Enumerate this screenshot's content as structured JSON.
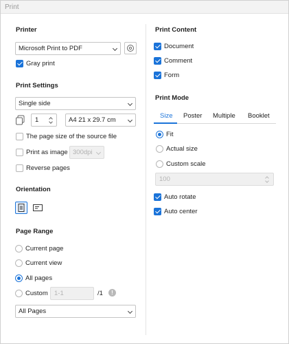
{
  "window": {
    "title": "Print"
  },
  "printer": {
    "section_title": "Printer",
    "selected": "Microsoft Print to PDF",
    "gray_print_label": "Gray print",
    "gray_print_checked": true
  },
  "print_settings": {
    "section_title": "Print Settings",
    "sides_selected": "Single side",
    "copies": "1",
    "paper_size": "A4 21 x 29.7 cm",
    "page_size_source_label": "The page size of the source file",
    "print_as_image_label": "Print as image",
    "dpi_value": "300dpi",
    "reverse_pages_label": "Reverse pages"
  },
  "orientation": {
    "section_title": "Orientation",
    "selected": "portrait"
  },
  "page_range": {
    "section_title": "Page Range",
    "options": [
      "Current page",
      "Current view",
      "All pages",
      "Custom"
    ],
    "selected": "All pages",
    "custom_placeholder": "1-1",
    "custom_total": "/1",
    "subset_selected": "All Pages"
  },
  "print_content": {
    "section_title": "Print Content",
    "document_label": "Document",
    "comment_label": "Comment",
    "form_label": "Form"
  },
  "print_mode": {
    "section_title": "Print Mode",
    "tabs": [
      "Size",
      "Poster",
      "Multiple",
      "Booklet"
    ],
    "active_tab": "Size",
    "size_options": [
      "Fit",
      "Actual size",
      "Custom scale"
    ],
    "size_selected": "Fit",
    "scale_value": "100",
    "auto_rotate_label": "Auto rotate",
    "auto_center_label": "Auto center"
  },
  "colors": {
    "accent": "#1a73d9"
  }
}
